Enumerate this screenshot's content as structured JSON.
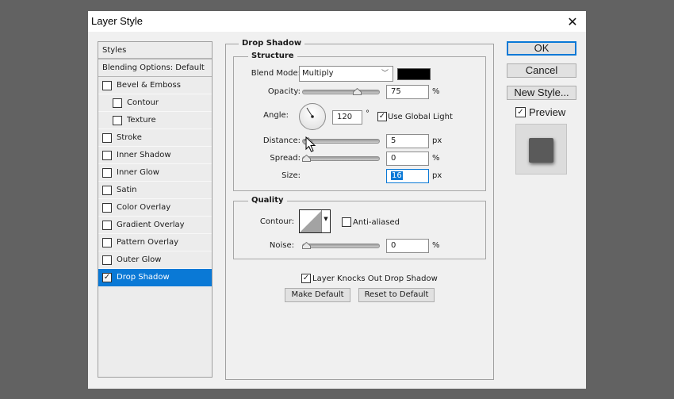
{
  "dialog": {
    "title": "Layer Style",
    "close_icon": "close-icon"
  },
  "styles_panel": {
    "header": "Styles",
    "blending_options": "Blending Options: Default",
    "items": [
      {
        "label": "Bevel & Emboss",
        "checked": false,
        "sub": false,
        "selected": false
      },
      {
        "label": "Contour",
        "checked": false,
        "sub": true,
        "selected": false
      },
      {
        "label": "Texture",
        "checked": false,
        "sub": true,
        "selected": false
      },
      {
        "label": "Stroke",
        "checked": false,
        "sub": false,
        "selected": false
      },
      {
        "label": "Inner Shadow",
        "checked": false,
        "sub": false,
        "selected": false
      },
      {
        "label": "Inner Glow",
        "checked": false,
        "sub": false,
        "selected": false
      },
      {
        "label": "Satin",
        "checked": false,
        "sub": false,
        "selected": false
      },
      {
        "label": "Color Overlay",
        "checked": false,
        "sub": false,
        "selected": false
      },
      {
        "label": "Gradient Overlay",
        "checked": false,
        "sub": false,
        "selected": false
      },
      {
        "label": "Pattern Overlay",
        "checked": false,
        "sub": false,
        "selected": false
      },
      {
        "label": "Outer Glow",
        "checked": false,
        "sub": false,
        "selected": false
      },
      {
        "label": "Drop Shadow",
        "checked": true,
        "sub": false,
        "selected": true
      }
    ]
  },
  "drop_shadow": {
    "section_title": "Drop Shadow",
    "structure": {
      "title": "Structure",
      "blend_mode_label": "Blend Mode:",
      "blend_mode_value": "Multiply",
      "shadow_color": "#000000",
      "opacity_label": "Opacity:",
      "opacity_value": "75",
      "opacity_unit": "%",
      "opacity_fraction": 0.75,
      "angle_label": "Angle:",
      "angle_value": "120",
      "angle_unit": "°",
      "use_global_light_label": "Use Global Light",
      "use_global_light_checked": true,
      "distance_label": "Distance:",
      "distance_value": "5",
      "distance_unit": "px",
      "distance_fraction": 0.02,
      "spread_label": "Spread:",
      "spread_value": "0",
      "spread_unit": "%",
      "spread_fraction": 0.0,
      "size_label": "Size:",
      "size_value": "16",
      "size_unit": "px"
    },
    "quality": {
      "title": "Quality",
      "contour_label": "Contour:",
      "anti_aliased_label": "Anti-aliased",
      "anti_aliased_checked": false,
      "noise_label": "Noise:",
      "noise_value": "0",
      "noise_unit": "%",
      "noise_fraction": 0.0
    },
    "knockout_label": "Layer Knocks Out Drop Shadow",
    "knockout_checked": true,
    "make_default_label": "Make Default",
    "reset_default_label": "Reset to Default"
  },
  "buttons": {
    "ok": "OK",
    "cancel": "Cancel",
    "new_style": "New Style...",
    "preview_label": "Preview",
    "preview_checked": true
  },
  "colors": {
    "accent": "#0a79d6",
    "preview_shape": "#5a5a5a"
  }
}
